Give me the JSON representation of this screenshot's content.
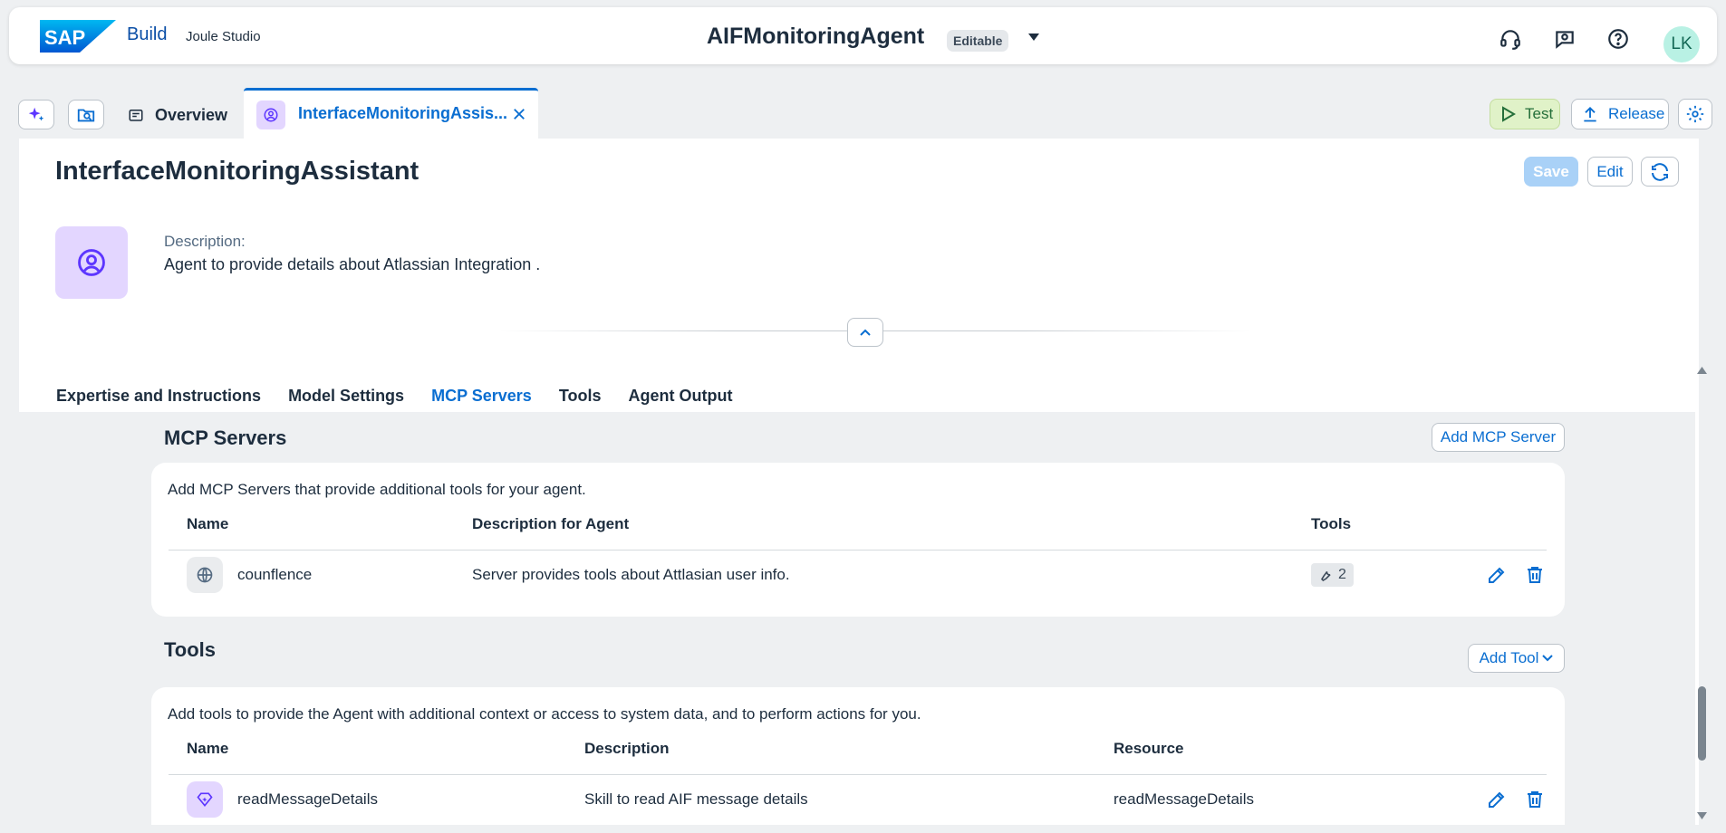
{
  "shell": {
    "brand": "SAP",
    "product": "Build",
    "app": "Joule Studio",
    "project_title": "AIFMonitoringAgent",
    "status_badge": "Editable",
    "avatar_initials": "LK",
    "icons": [
      "headset-icon",
      "feedback-icon",
      "help-icon"
    ]
  },
  "tabs": {
    "overview_label": "Overview",
    "active_label": "InterfaceMonitoringAssis...",
    "test_label": "Test",
    "release_label": "Release"
  },
  "agent": {
    "title": "InterfaceMonitoringAssistant",
    "save_label": "Save",
    "edit_label": "Edit",
    "description_label": "Description:",
    "description": "Agent to provide details about Atlassian Integration ."
  },
  "sub_tabs": [
    {
      "label": "Expertise and Instructions"
    },
    {
      "label": "Model Settings"
    },
    {
      "label": "MCP Servers"
    },
    {
      "label": "Tools"
    },
    {
      "label": "Agent Output"
    }
  ],
  "mcp": {
    "title": "MCP Servers",
    "add_label": "Add MCP Server",
    "intro": "Add MCP Servers that provide additional tools for your agent.",
    "columns": {
      "name": "Name",
      "description": "Description for Agent",
      "tools": "Tools"
    },
    "rows": [
      {
        "name": "counflence",
        "description": "Server provides tools about Attlasian user info.",
        "tools": "2"
      }
    ]
  },
  "tools": {
    "title": "Tools",
    "add_label": "Add Tool",
    "intro": "Add tools to provide the Agent with additional context or access to system data, and to perform actions for you.",
    "columns": {
      "name": "Name",
      "description": "Description",
      "resource": "Resource"
    },
    "rows": [
      {
        "name": "readMessageDetails",
        "description": "Skill to read AIF message details",
        "resource": "readMessageDetails"
      }
    ]
  },
  "colors": {
    "accent": "#0a6ed1",
    "brand_blue": "#0a4ea6",
    "purple_tint": "#e3d6ff",
    "purple_icon": "#5d36ff",
    "test_green": "#e0f2c8"
  }
}
